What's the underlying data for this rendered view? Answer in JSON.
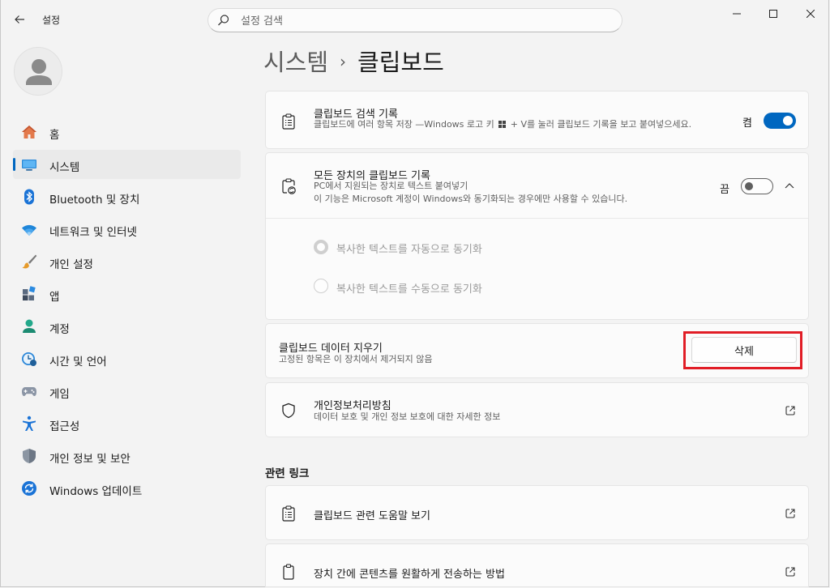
{
  "window": {
    "app_title": "설정",
    "search_placeholder": "설정 검색"
  },
  "sidebar": {
    "items": [
      {
        "label": "홈"
      },
      {
        "label": "시스템"
      },
      {
        "label": "Bluetooth 및 장치"
      },
      {
        "label": "네트워크 및 인터넷"
      },
      {
        "label": "개인 설정"
      },
      {
        "label": "앱"
      },
      {
        "label": "계정"
      },
      {
        "label": "시간 및 언어"
      },
      {
        "label": "게임"
      },
      {
        "label": "접근성"
      },
      {
        "label": "개인 정보 및 보안"
      },
      {
        "label": "Windows 업데이트"
      }
    ]
  },
  "breadcrumb": {
    "parent": "시스템",
    "separator": "›",
    "current": "클립보드"
  },
  "clipboard_history": {
    "title": "클립보드 검색 기록",
    "desc_before": "클립보드에 여러 항목 저장 —Windows 로고 키",
    "desc_after": "+ V를 눌러 클립보드 기록을 보고 붙여넣으세요.",
    "state_label": "켬"
  },
  "sync": {
    "title": "모든 장치의 클립보드 기록",
    "desc1": "PC에서 지원되는 장치로 텍스트 붙여넣기",
    "desc2": "이 기능은 Microsoft 계정이 Windows와 동기화되는 경우에만 사용할 수 있습니다.",
    "state_label": "끔",
    "option_auto": "복사한 텍스트를 자동으로 동기화",
    "option_manual": "복사한 텍스트를 수동으로 동기화"
  },
  "clear": {
    "title": "클립보드 데이터 지우기",
    "desc": "고정된 항목은 이 장치에서 제거되지 않음",
    "button": "삭제"
  },
  "privacy": {
    "title": "개인정보처리방침",
    "desc": "데이터 보호 및 개인 정보 보호에 대한 자세한 정보"
  },
  "related": {
    "heading": "관련 링크",
    "links": [
      {
        "label": "클립보드 관련 도움말 보기"
      },
      {
        "label": "장치 간에 콘텐츠를 원활하게 전송하는 방법"
      }
    ]
  },
  "colors": {
    "accent": "#0067c0",
    "highlight": "#e11d26"
  }
}
